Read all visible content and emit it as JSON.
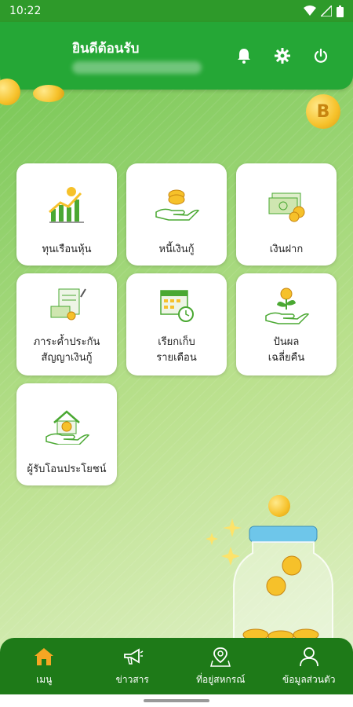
{
  "status_bar": {
    "time": "10:22"
  },
  "header": {
    "welcome": "ยินดีต้อนรับ",
    "username": "— — — — — —",
    "bell_icon": "bell-icon",
    "settings_icon": "gear-icon",
    "power_icon": "power-icon"
  },
  "menu": {
    "cards": [
      {
        "label": "ทุนเรือนหุ้น",
        "icon": "stock-growth-icon"
      },
      {
        "label": "หนี้เงินกู้",
        "icon": "coin-hand-icon"
      },
      {
        "label": "เงินฝาก",
        "icon": "money-deposit-icon"
      },
      {
        "label_line1": "ภาระค้ำประกัน",
        "label_line2": "สัญญาเงินกู้",
        "icon": "guarantee-document-icon"
      },
      {
        "label_line1": "เรียกเก็บ",
        "label_line2": "รายเดือน",
        "icon": "calendar-clock-icon"
      },
      {
        "label_line1": "ปันผล",
        "label_line2": "เฉลี่ยคืน",
        "icon": "dividend-plant-icon"
      },
      {
        "label": "ผู้รับโอนประโยชน์",
        "icon": "house-hand-icon"
      }
    ]
  },
  "bottom_nav": {
    "items": [
      {
        "label": "เมนู",
        "icon": "home-icon",
        "active": true
      },
      {
        "label": "ข่าวสาร",
        "icon": "megaphone-icon",
        "active": false
      },
      {
        "label": "ที่อยู่สหกรณ์",
        "icon": "map-pin-icon",
        "active": false
      },
      {
        "label": "ข้อมูลส่วนตัว",
        "icon": "user-icon",
        "active": false
      }
    ]
  },
  "colors": {
    "header_green": "#25a736",
    "nav_green": "#1e7a18",
    "coin_gold": "#f6c12a",
    "active_icon": "#f5a623"
  }
}
